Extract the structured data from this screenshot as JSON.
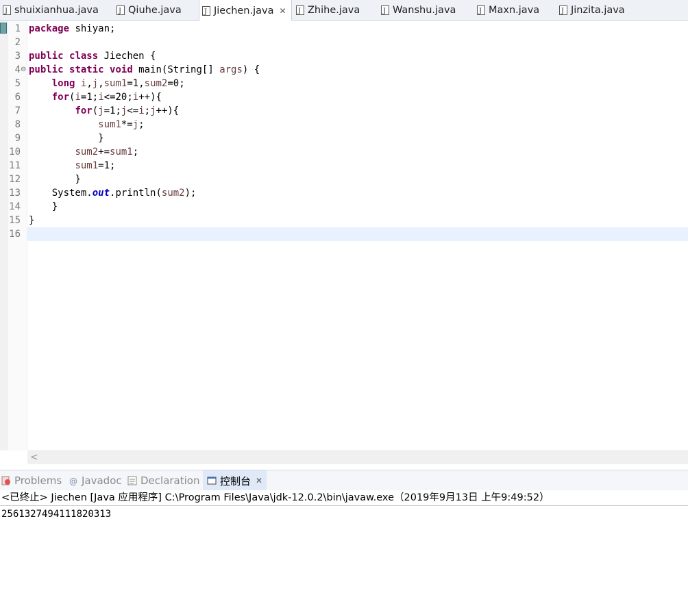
{
  "editor_tabs": [
    {
      "label": "shuixianhua.java",
      "active": false
    },
    {
      "label": "Qiuhe.java",
      "active": false
    },
    {
      "label": "Jiechen.java",
      "active": true
    },
    {
      "label": "Zhihe.java",
      "active": false
    },
    {
      "label": "Wanshu.java",
      "active": false
    },
    {
      "label": "Maxn.java",
      "active": false
    },
    {
      "label": "Jinzita.java",
      "active": false
    }
  ],
  "tab_close_glyph": "✕",
  "line_numbers": [
    "1",
    "2",
    "3",
    "4",
    "5",
    "6",
    "7",
    "8",
    "9",
    "10",
    "11",
    "12",
    "13",
    "14",
    "15",
    "16"
  ],
  "fold_marker": "⊖",
  "code": {
    "l1_kw": "package",
    "l1_rest": " shiyan;",
    "l3_kw1": "public",
    "l3_kw2": "class",
    "l3_rest": " Jiechen {",
    "l4_kw1": "public",
    "l4_kw2": "static",
    "l4_kw3": "void",
    "l4_mid": " main(String[] ",
    "l4_var": "args",
    "l4_end": ") {",
    "l5_kw": "long",
    "l5_v1": "i",
    "l5_c1": ",",
    "l5_v2": "j",
    "l5_c2": ",",
    "l5_v3": "sum1",
    "l5_c3": "=1,",
    "l5_v4": "sum2",
    "l5_c4": "=0;",
    "l6_kw": "for",
    "l6_a": "(",
    "l6_v1": "i",
    "l6_b": "=1;",
    "l6_v2": "i",
    "l6_c": "<=20;",
    "l6_v3": "i",
    "l6_d": "++){",
    "l7_kw": "for",
    "l7_a": "(",
    "l7_v1": "j",
    "l7_b": "=1;",
    "l7_v2": "j",
    "l7_c": "<=",
    "l7_v3": "i",
    "l7_d": ";",
    "l7_v4": "j",
    "l7_e": "++){",
    "l8_v1": "sum1",
    "l8_a": "*=",
    "l8_v2": "j",
    "l8_b": ";",
    "l9": "}",
    "l10_v1": "sum2",
    "l10_a": "+=",
    "l10_v2": "sum1",
    "l10_b": ";",
    "l11_v1": "sum1",
    "l11_a": "=1;",
    "l12": "}",
    "l13_a": "System.",
    "l13_fld": "out",
    "l13_b": ".println(",
    "l13_v": "sum2",
    "l13_c": ");",
    "l14": "}",
    "l15": "}"
  },
  "scroll_left_glyph": "<",
  "view_tabs": [
    {
      "label": "Problems",
      "active": false
    },
    {
      "label": "Javadoc",
      "active": false
    },
    {
      "label": "Declaration",
      "active": false
    },
    {
      "label": "控制台",
      "active": true
    }
  ],
  "console": {
    "header": "<已终止> Jiechen [Java 应用程序] C:\\Program Files\\Java\\jdk-12.0.2\\bin\\javaw.exe（2019年9月13日 上午9:49:52）",
    "output": "2561327494111820313"
  },
  "colors": {
    "keyword": "#7f0055",
    "variable": "#6a3e3e",
    "field": "#0000c0",
    "current_line": "#e8f2fe",
    "line_number": "#787878"
  }
}
